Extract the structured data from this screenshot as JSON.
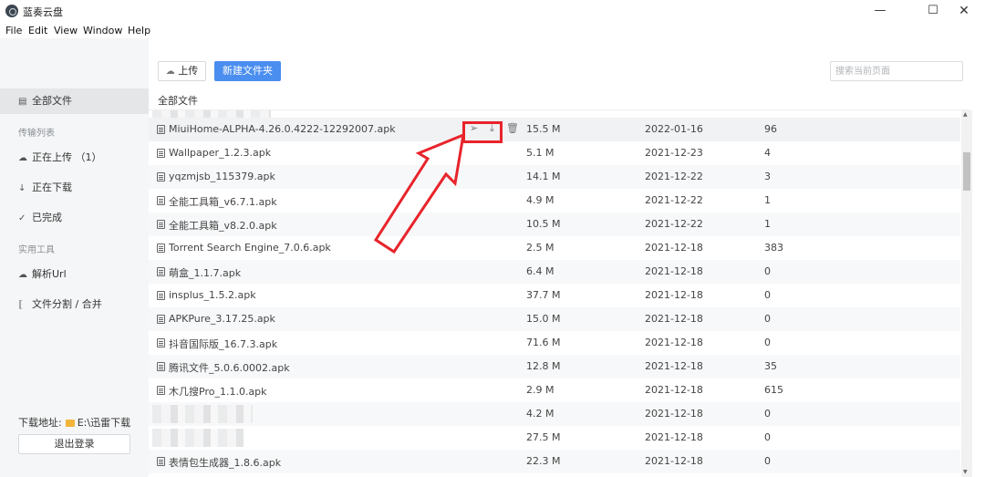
{
  "window": {
    "title": "蓝奏云盘",
    "min_glyph": "—",
    "max_glyph": "☐",
    "close_glyph": "✕"
  },
  "menu": [
    "File",
    "Edit",
    "View",
    "Window",
    "Help"
  ],
  "sidebar": {
    "all_files": "全部文件",
    "transfer_header": "传输列表",
    "uploading": "正在上传 （1）",
    "downloading": "正在下载",
    "completed": "已完成",
    "tools_header": "实用工具",
    "parse_url": "解析Url",
    "split_merge": "文件分割 / 合并",
    "download_path_label": "下载地址:",
    "download_path": "E:\\迅雷下载",
    "logout": "退出登录",
    "icons": [
      "folder-list-icon",
      "cloud-upload-icon",
      "download-icon",
      "check-circle-icon",
      "cloud-link-icon",
      "split-icon"
    ]
  },
  "toolbar": {
    "upload_label": "上传",
    "new_folder_label": "新建文件夹",
    "search_placeholder": "搜索当前页面"
  },
  "breadcrumb": "全部文件",
  "files": [
    {
      "name": "MiuiHome-ALPHA-4.26.0.4222-12292007.apk",
      "size": "15.5 M",
      "date": "2022-01-16",
      "downloads": "96"
    },
    {
      "name": "Wallpaper_1.2.3.apk",
      "size": "5.1 M",
      "date": "2021-12-23",
      "downloads": "4"
    },
    {
      "name": "yqzmjsb_115379.apk",
      "size": "14.1 M",
      "date": "2021-12-22",
      "downloads": "3"
    },
    {
      "name": "全能工具箱_v6.7.1.apk",
      "size": "4.9 M",
      "date": "2021-12-22",
      "downloads": "1"
    },
    {
      "name": "全能工具箱_v8.2.0.apk",
      "size": "10.5 M",
      "date": "2021-12-22",
      "downloads": "1"
    },
    {
      "name": "Torrent Search Engine_7.0.6.apk",
      "size": "2.5 M",
      "date": "2021-12-18",
      "downloads": "383"
    },
    {
      "name": "萌盒_1.1.7.apk",
      "size": "6.4 M",
      "date": "2021-12-18",
      "downloads": "0"
    },
    {
      "name": "insplus_1.5.2.apk",
      "size": "37.7 M",
      "date": "2021-12-18",
      "downloads": "0"
    },
    {
      "name": "APKPure_3.17.25.apk",
      "size": "15.0 M",
      "date": "2021-12-18",
      "downloads": "0"
    },
    {
      "name": "抖音国际版_16.7.3.apk",
      "size": "71.6 M",
      "date": "2021-12-18",
      "downloads": "0"
    },
    {
      "name": "腾讯文件_5.0.6.0002.apk",
      "size": "12.8 M",
      "date": "2021-12-18",
      "downloads": "35"
    },
    {
      "name": "木几搜Pro_1.1.0.apk",
      "size": "2.9 M",
      "date": "2021-12-18",
      "downloads": "615"
    },
    {
      "name": "",
      "size": "4.2 M",
      "date": "2021-12-18",
      "downloads": "0"
    },
    {
      "name": "",
      "size": "27.5 M",
      "date": "2021-12-18",
      "downloads": "0"
    },
    {
      "name": "表情包生成器_1.8.6.apk",
      "size": "22.3 M",
      "date": "2021-12-18",
      "downloads": "0"
    }
  ],
  "row_actions": {
    "share_icon": "send-icon",
    "download_icon": "download-icon",
    "delete_icon": "trash-icon"
  },
  "annotation_color": "#e8242b",
  "accent_color": "#4a8ef0"
}
